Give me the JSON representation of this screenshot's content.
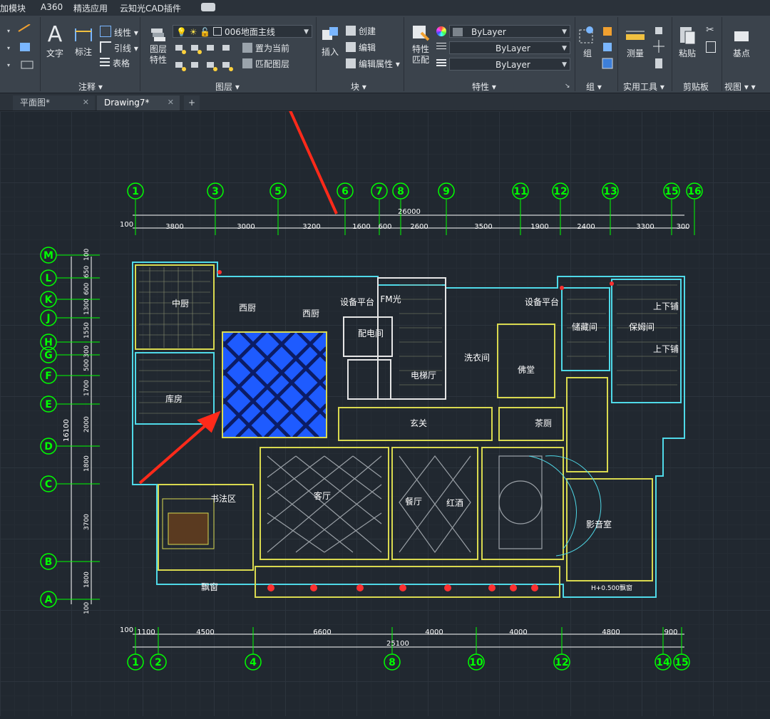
{
  "menubar": [
    "加模块",
    "A360",
    "精选应用",
    "云知光CAD插件"
  ],
  "ribbon": {
    "annotation": {
      "text_label": "文字",
      "dimension_label": "标注",
      "linear_label": "线性",
      "leader_label": "引线",
      "table_label": "表格",
      "title": "注释"
    },
    "layers": {
      "props_label": "图层\n特性",
      "current_layer": "006地面主线",
      "set_current_label": "置为当前",
      "match_label": "匹配图层",
      "title": "图层"
    },
    "block": {
      "insert_label": "插入",
      "create_label": "创建",
      "edit_label": "编辑",
      "edit_attr_label": "编辑属性",
      "title": "块"
    },
    "properties": {
      "match_label": "特性\n匹配",
      "color": "ByLayer",
      "linetype": "ByLayer",
      "lineweight": "ByLayer",
      "title": "特性"
    },
    "groups": {
      "group_label": "组",
      "title": "组"
    },
    "utilities": {
      "measure_label": "测量",
      "title": "实用工具"
    },
    "clipboard": {
      "paste_label": "粘贴",
      "title": "剪贴板"
    },
    "view": {
      "base_label": "基点",
      "title": "视图"
    }
  },
  "tabs": [
    {
      "label": "平面图*",
      "active": false
    },
    {
      "label": "Drawing7*",
      "active": true
    }
  ],
  "drawing": {
    "top_axes": [
      "1",
      "3",
      "5",
      "6",
      "7",
      "8",
      "9",
      "11",
      "12",
      "13",
      "15",
      "16"
    ],
    "top_overall": "26000",
    "top_dims": [
      "3800",
      "3000",
      "3200",
      "1600",
      "600",
      "2600",
      "3500",
      "1900",
      "2400",
      "3300",
      "300"
    ],
    "top_offset": "100",
    "left_axes": [
      "M",
      "L",
      "K",
      "J",
      "H",
      "G",
      "F",
      "E",
      "D",
      "C",
      "B",
      "A"
    ],
    "left_overall": "16100",
    "left_dims": [
      "100",
      "650",
      "600",
      "1300",
      "1550",
      "300",
      "500",
      "1700",
      "2000",
      "1800",
      "3700",
      "1800",
      "100"
    ],
    "bottom_axes": [
      "1",
      "2",
      "4",
      "8",
      "10",
      "12",
      "14",
      "15"
    ],
    "bottom_overall": "25100",
    "bottom_dims": [
      "1100",
      "4500",
      "6600",
      "4000",
      "4000",
      "4800",
      "900"
    ],
    "bottom_offset": "100",
    "rooms": [
      "中厨",
      "西厨",
      "西厨",
      "配电间",
      "电梯厅",
      "设备平台",
      "FM光",
      "设备平台",
      "储藏间",
      "保姆间",
      "上下铺",
      "上下铺",
      "洗衣间",
      "佛堂",
      "库房",
      "玄关",
      "茶厕",
      "客厅",
      "餐厅",
      "红酒",
      "书法区",
      "影音室",
      "飘窗",
      "H+0.500飘窗"
    ]
  },
  "colors": {
    "grid_axis": "#00ff00",
    "hatch_blue": "#1e5bff",
    "dimension": "#ffffff",
    "wall": "#ffff66",
    "arrow": "#ff2a1a",
    "ribbon_bg": "#3b434c"
  }
}
